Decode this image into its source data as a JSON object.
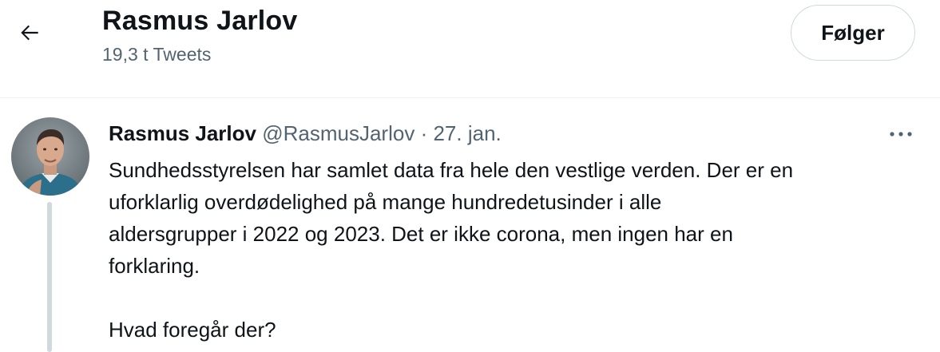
{
  "header": {
    "title": "Rasmus Jarlov",
    "subtitle": "19,3 t Tweets",
    "back_icon": "arrow-left-icon",
    "follow_label": "Følger"
  },
  "tweet": {
    "author_name": "Rasmus Jarlov",
    "author_handle": "@RasmusJarlov",
    "separator": "·",
    "date": "27. jan.",
    "more_icon": "more-horizontal-icon",
    "paragraph_1": "Sundhedsstyrelsen har samlet data fra hele den vestlige verden. Der er en\nuforklarlig overdødelighed på mange hundredetusinder i alle\naldersgrupper i 2022 og 2023. Det er ikke corona, men ingen har en\nforklaring.",
    "paragraph_2": "Hvad foregår der?"
  },
  "colors": {
    "text_primary": "#0f1419",
    "text_secondary": "#536471",
    "border": "#cfd9de",
    "background": "#ffffff"
  }
}
